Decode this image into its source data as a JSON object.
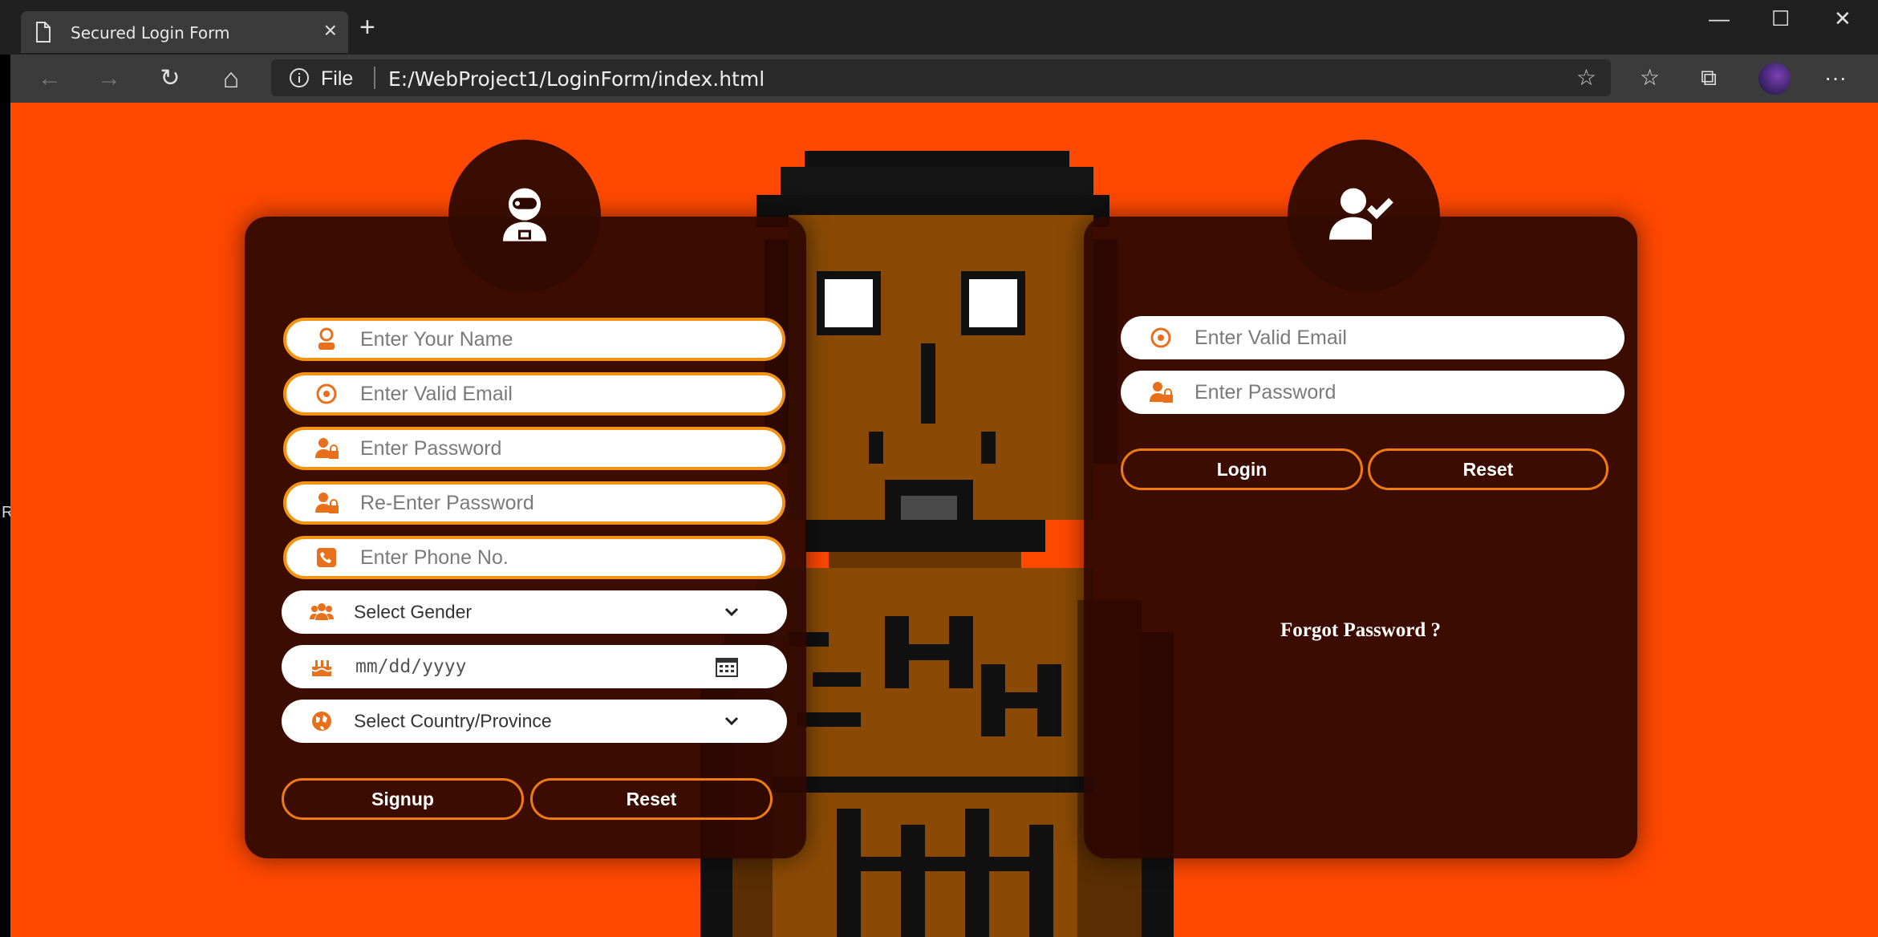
{
  "browser": {
    "tab_title": "Secured Login Form",
    "tab_close": "×",
    "new_tab": "+",
    "minimize": "—",
    "maximize": "☐",
    "close": "✕",
    "protocol_label": "File",
    "url": "E:/WebProject1/LoginForm/index.html",
    "back_icon": "←",
    "forward_icon": "→",
    "refresh_icon": "↻",
    "home_icon": "⌂",
    "star_icon": "☆",
    "favorites_icon": "☆",
    "collections_icon": "⧉",
    "more_icon": "···"
  },
  "left_edge_text": "R",
  "accent_color": "#ff4800",
  "field_border_color": "#f29411",
  "signup": {
    "badge_icon": "astronaut-icon",
    "name_placeholder": "Enter Your Name",
    "email_placeholder": "Enter Valid Email",
    "password_placeholder": "Enter Password",
    "reenter_password_placeholder": "Re-Enter Password",
    "phone_placeholder": "Enter Phone No.",
    "gender_select": "Select Gender",
    "date_placeholder": "mm/dd/yyyy",
    "country_select": "Select Country/Province",
    "signup_button": "Signup",
    "reset_button": "Reset"
  },
  "login": {
    "badge_icon": "user-check-icon",
    "email_placeholder": "Enter Valid Email",
    "password_placeholder": "Enter Password",
    "login_button": "Login",
    "reset_button": "Reset",
    "forgot_password": "Forgot Password ?"
  }
}
